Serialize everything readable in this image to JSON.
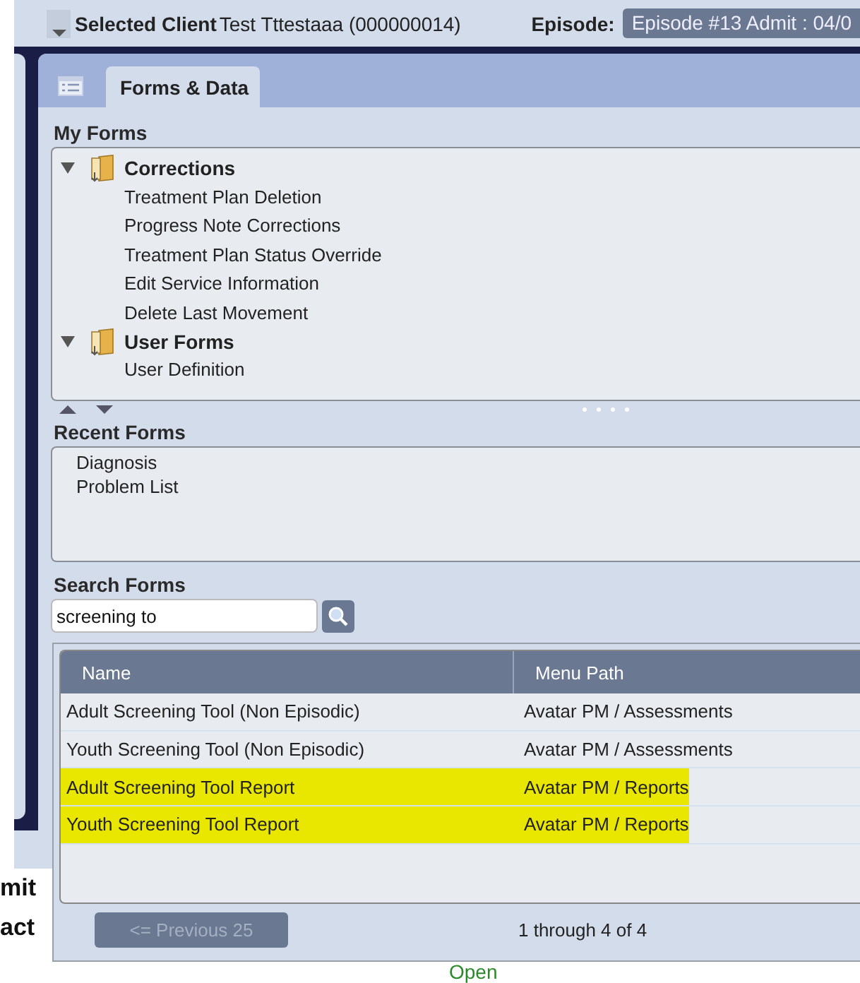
{
  "header": {
    "label": "Selected Client",
    "client": "Test Tttestaaa (000000014)",
    "episode_label": "Episode:",
    "episode": "Episode #13 Admit : 04/0"
  },
  "tabs": [
    {
      "label": "Forms & Data",
      "selected": true
    }
  ],
  "my_forms": {
    "title": "My Forms",
    "tree": [
      {
        "label": "Corrections",
        "expanded": true,
        "children": [
          {
            "label": "Treatment Plan Deletion"
          },
          {
            "label": "Progress Note Corrections"
          },
          {
            "label": "Treatment Plan Status Override"
          },
          {
            "label": "Edit Service Information"
          },
          {
            "label": "Delete Last Movement"
          }
        ]
      },
      {
        "label": "User Forms",
        "expanded": true,
        "children": [
          {
            "label": "User Definition"
          }
        ]
      }
    ]
  },
  "recent_forms": {
    "title": "Recent Forms",
    "items": [
      "Diagnosis",
      "Problem List"
    ]
  },
  "search_forms": {
    "title": "Search Forms",
    "value": "screening to"
  },
  "results": {
    "columns": [
      "Name",
      "Menu Path"
    ],
    "rows": [
      {
        "name": "Adult Screening Tool (Non Episodic)",
        "path": "Avatar PM / Assessments",
        "highlighted": false
      },
      {
        "name": "Youth Screening Tool (Non Episodic)",
        "path": "Avatar PM / Assessments",
        "highlighted": false
      },
      {
        "name": "Adult Screening Tool Report",
        "path": "Avatar PM / Reports",
        "highlighted": true
      },
      {
        "name": "Youth Screening Tool Report",
        "path": "Avatar PM / Reports",
        "highlighted": true
      }
    ],
    "pager": {
      "previous": "<= Previous 25",
      "previous_disabled": true,
      "range": "1 through 4 of 4"
    }
  },
  "background": {
    "texts": [
      "mit",
      "act"
    ],
    "link": "Open"
  }
}
